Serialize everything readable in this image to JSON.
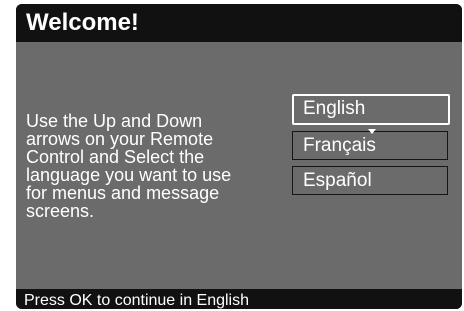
{
  "title_bar": {
    "title": "Welcome!"
  },
  "content": {
    "instructions": [
      "Use the Up and Down",
      "arrows on your Remote",
      "Control and Select the",
      "language you want to use",
      "for menus and message",
      "screens."
    ]
  },
  "language_menu": {
    "selected_index": 0,
    "options": [
      {
        "label": "English"
      },
      {
        "label": "Français"
      },
      {
        "label": "Español"
      }
    ]
  },
  "status_bar": {
    "text": "Press OK to continue in English"
  },
  "colors": {
    "frame": "#111111",
    "panel": "#6b6b6b",
    "text": "#ffffff",
    "selection_border": "#ffffff"
  }
}
